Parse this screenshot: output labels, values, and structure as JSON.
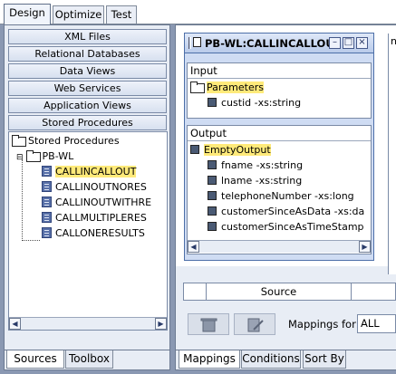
{
  "top_tabs": [
    "Design",
    "Optimize",
    "Test"
  ],
  "categories": [
    "XML Files",
    "Relational Databases",
    "Data Views",
    "Web Services",
    "Application Views",
    "Stored Procedures"
  ],
  "tree": {
    "root": "Stored Procedures",
    "folder": "PB-WL",
    "items": [
      "CALLINCALLOUT",
      "CALLINOUTNORES",
      "CALLINOUTWITHRE",
      "CALLMULTIPLERES",
      "CALLONERESULTS"
    ]
  },
  "left_bottom_tabs": [
    "Sources",
    "Toolbox"
  ],
  "node": {
    "title": "PB-WL:CALLINCALLOU",
    "input_label": "Input",
    "input_group": "Parameters",
    "input_fields": [
      "custid -xs:string"
    ],
    "output_label": "Output",
    "output_group": "EmptyOutput",
    "output_fields": [
      "fname -xs:string",
      "lname -xs:string",
      "telephoneNumber -xs:long",
      "customerSinceAsData -xs:da",
      "customerSinceAsTimeStamp"
    ]
  },
  "mapper": {
    "grid_header": "Source",
    "mappings_for_label": "Mappings for:",
    "mappings_for_value": "ALL"
  },
  "center_bottom_tabs": [
    "Mappings",
    "Conditions",
    "Sort By"
  ],
  "right_edge_text": "n"
}
